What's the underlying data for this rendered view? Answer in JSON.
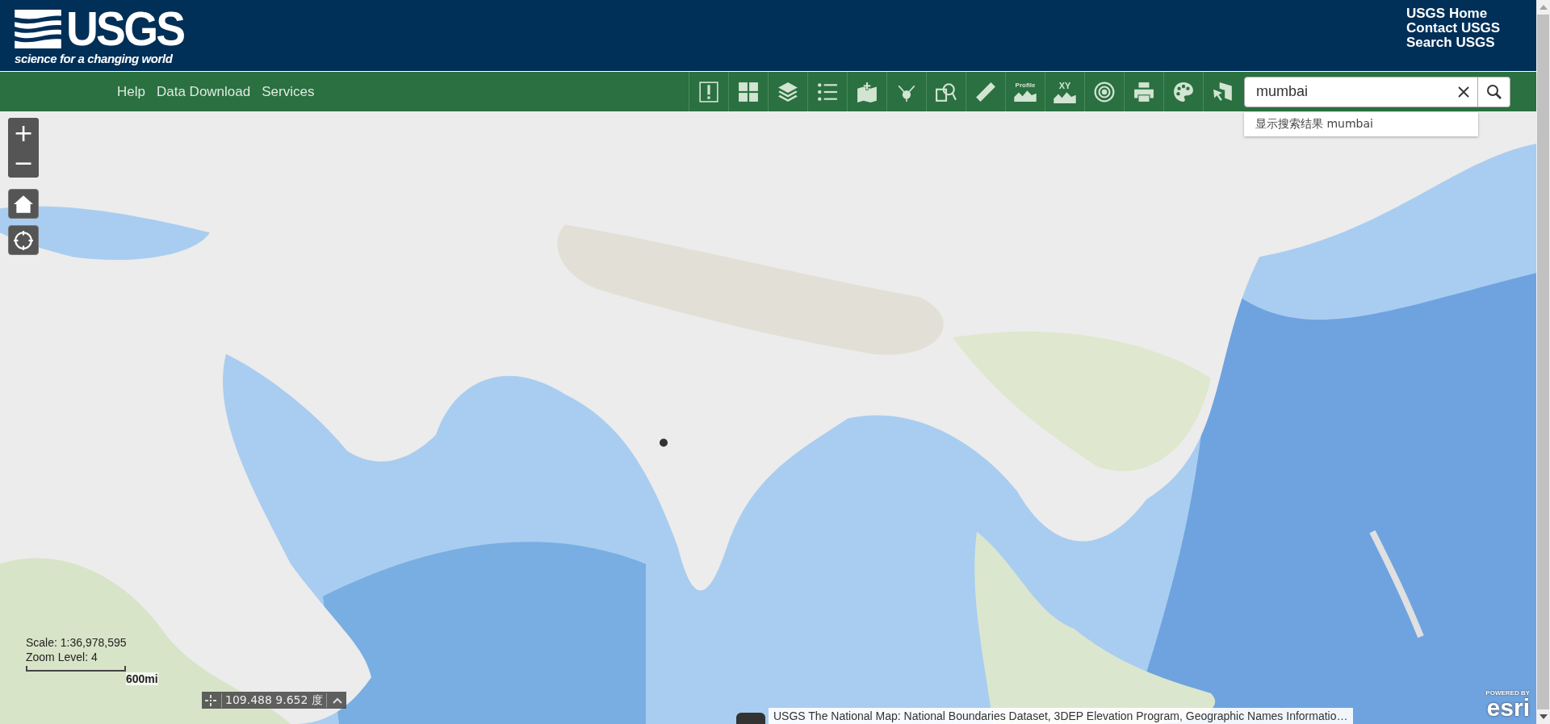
{
  "header": {
    "logo": {
      "wordmark": "USGS",
      "tagline": "science for a changing world"
    },
    "links": [
      "USGS Home",
      "Contact USGS",
      "Search USGS"
    ]
  },
  "nav": {
    "menu": [
      "Help",
      "Data Download",
      "Services"
    ],
    "tools": [
      {
        "kind": "alert"
      },
      {
        "kind": "grid"
      },
      {
        "kind": "layers"
      },
      {
        "kind": "list"
      },
      {
        "kind": "map-add"
      },
      {
        "kind": "share"
      },
      {
        "kind": "doc-search"
      },
      {
        "kind": "ruler"
      },
      {
        "kind": "profile",
        "label": "Profile"
      },
      {
        "kind": "xy",
        "label": "XY"
      },
      {
        "kind": "target"
      },
      {
        "kind": "printer"
      },
      {
        "kind": "palette"
      },
      {
        "kind": "pointer"
      }
    ],
    "search": {
      "value": "mumbai",
      "suggestion": "显示搜索结果 mumbai"
    }
  },
  "map": {
    "kind": "picture",
    "zoom_in": "+",
    "zoom_out": "−",
    "scale": "Scale: 1:36,978,595",
    "zoom_level": "Zoom Level: 4",
    "scale_bar": "600mi",
    "coordinates": "109.488 9.652 度",
    "attribution": "USGS The National Map: National Boundaries Dataset, 3DEP Elevation Program, Geographic Names Informatio…",
    "esri": {
      "powered": "POWERED BY",
      "logo": "esri"
    }
  }
}
